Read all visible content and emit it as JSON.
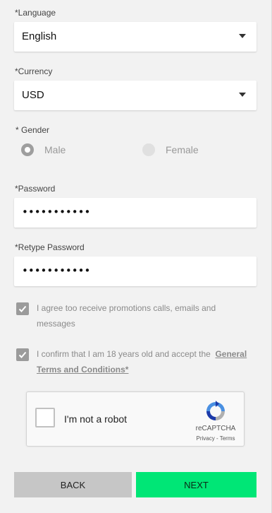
{
  "language": {
    "label": "*Language",
    "value": "English"
  },
  "currency": {
    "label": "*Currency",
    "value": "USD"
  },
  "gender": {
    "label": "* Gender",
    "options": [
      {
        "label": "Male",
        "selected": true
      },
      {
        "label": "Female",
        "selected": false
      }
    ]
  },
  "password": {
    "label": "*Password",
    "value": "•••••••••••"
  },
  "retype_password": {
    "label": "*Retype Password",
    "value": "•••••••••••"
  },
  "promotions_consent": {
    "text": "I agree too receive promotions calls, emails and messages",
    "checked": true
  },
  "age_consent": {
    "text": "I confirm that I am 18 years old and accept the",
    "link": "General Terms and Conditions*",
    "checked": true
  },
  "captcha": {
    "label": "I'm not a robot",
    "brand": "reCAPTCHA",
    "links": "Privacy - Terms"
  },
  "buttons": {
    "back": "BACK",
    "next": "NEXT"
  },
  "colors": {
    "next_button": "#00e676",
    "back_button": "#c6c6c6",
    "checkbox": "#9b9b9b"
  }
}
